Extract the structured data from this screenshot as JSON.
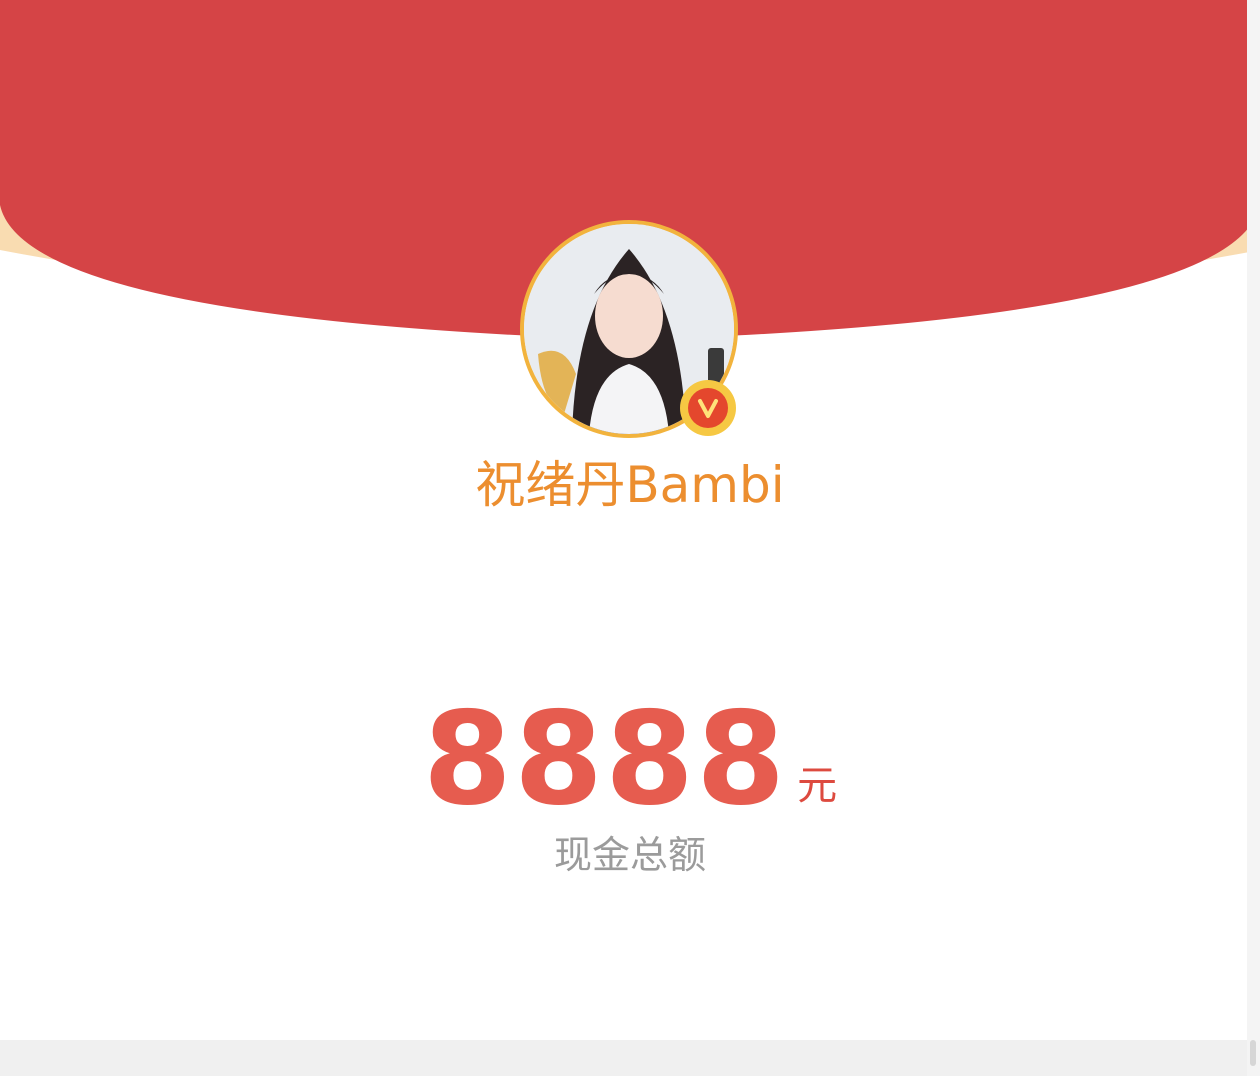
{
  "colors": {
    "header_red": "#d54446",
    "header_cream": "#f9dcb1",
    "username": "#ec8e2f",
    "amount": "#e65c4f",
    "label_gray": "#9b9b9b",
    "avatar_ring": "#f2b33d",
    "verified_badge": "#e4472d"
  },
  "profile": {
    "username": "祝绪丹Bambi",
    "avatar_icon": "user-avatar",
    "verified_icon": "verified-v-icon",
    "verified_letter": "V"
  },
  "reward": {
    "amount": "8888",
    "unit": "元",
    "label": "现金总额"
  }
}
